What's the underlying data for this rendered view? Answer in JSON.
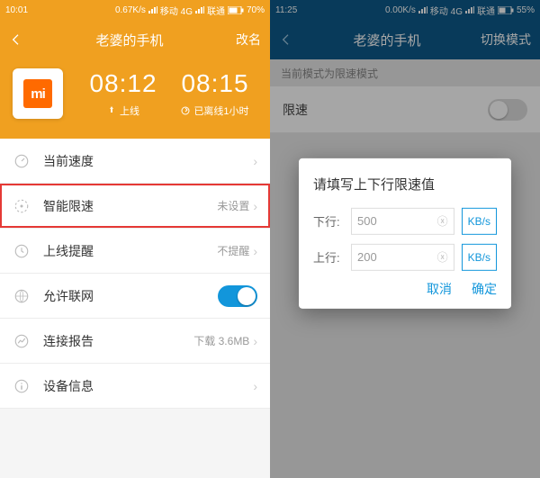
{
  "left": {
    "status": {
      "time": "10:01",
      "speed": "0.67K/s",
      "carrier1": "移动 4G",
      "carrier2": "联通",
      "battery": "70%"
    },
    "header": {
      "title": "老婆的手机",
      "action": "改名"
    },
    "hero": {
      "time1": "08:12",
      "sub1": "上线",
      "time2": "08:15",
      "sub2": "已离线1小时"
    },
    "rows": {
      "speed": {
        "label": "当前速度",
        "value": ""
      },
      "limit": {
        "label": "智能限速",
        "value": "未设置"
      },
      "online": {
        "label": "上线提醒",
        "value": "不提醒"
      },
      "net": {
        "label": "允许联网"
      },
      "report": {
        "label": "连接报告",
        "value": "下载 3.6MB"
      },
      "info": {
        "label": "设备信息",
        "value": ""
      }
    }
  },
  "right": {
    "status": {
      "time": "11:25",
      "speed": "0.00K/s",
      "carrier1": "移动 4G",
      "carrier2": "联通",
      "battery": "55%"
    },
    "header": {
      "title": "老婆的手机",
      "action": "切换模式"
    },
    "strip": "当前模式为限速模式",
    "row_label": "限速",
    "modal": {
      "title": "请填写上下行限速值",
      "down_label": "下行:",
      "down_value": "500",
      "down_unit": "KB/s",
      "up_label": "上行:",
      "up_value": "200",
      "up_unit": "KB/s",
      "cancel": "取消",
      "ok": "确定"
    }
  }
}
